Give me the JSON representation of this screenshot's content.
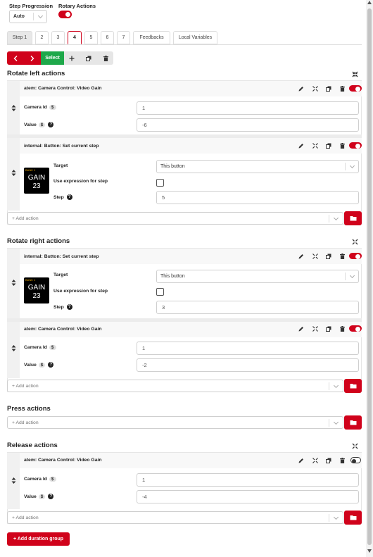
{
  "top": {
    "step_progression_label": "Step Progression",
    "step_progression_value": "Auto",
    "rotary_actions_label": "Rotary Actions",
    "rotary_actions_on": true
  },
  "tabs": [
    "Step 1",
    "2",
    "3",
    "4",
    "5",
    "6",
    "7",
    "Feedbacks",
    "Local Variables"
  ],
  "active_tab": "4",
  "toolbar": {
    "select_label": "Select"
  },
  "sections": {
    "rotate_left": "Rotate left actions",
    "rotate_right": "Rotate right actions",
    "press": "Press actions",
    "release": "Release actions"
  },
  "fields": {
    "camera_id": "Camera Id",
    "value": "Value",
    "target": "Target",
    "use_expression": "Use expression for step",
    "step": "Step",
    "var_badge": "$"
  },
  "rl_action1": {
    "title": "atem: Camera Control: Video Gain",
    "camera_id": "1",
    "value": "-6"
  },
  "rl_action2": {
    "title": "internal: Button: Set current step",
    "target": "This button",
    "step": "5"
  },
  "rr_action1": {
    "title": "internal: Button: Set current step",
    "target": "This button",
    "step": "3"
  },
  "rr_action2": {
    "title": "atem: Camera Control: Video Gain",
    "camera_id": "1",
    "value": "-2"
  },
  "rel_action1": {
    "title": "atem: Camera Control: Video Gain",
    "camera_id": "1",
    "value": "-4"
  },
  "button_preview": {
    "top_text": "BANK 1",
    "line1": "GAIN",
    "line2": "23"
  },
  "add_action_placeholder": "+ Add action",
  "add_duration_group": "+ Add duration group",
  "colors": {
    "accent": "#d0021b",
    "select_green": "#1ea84a"
  }
}
